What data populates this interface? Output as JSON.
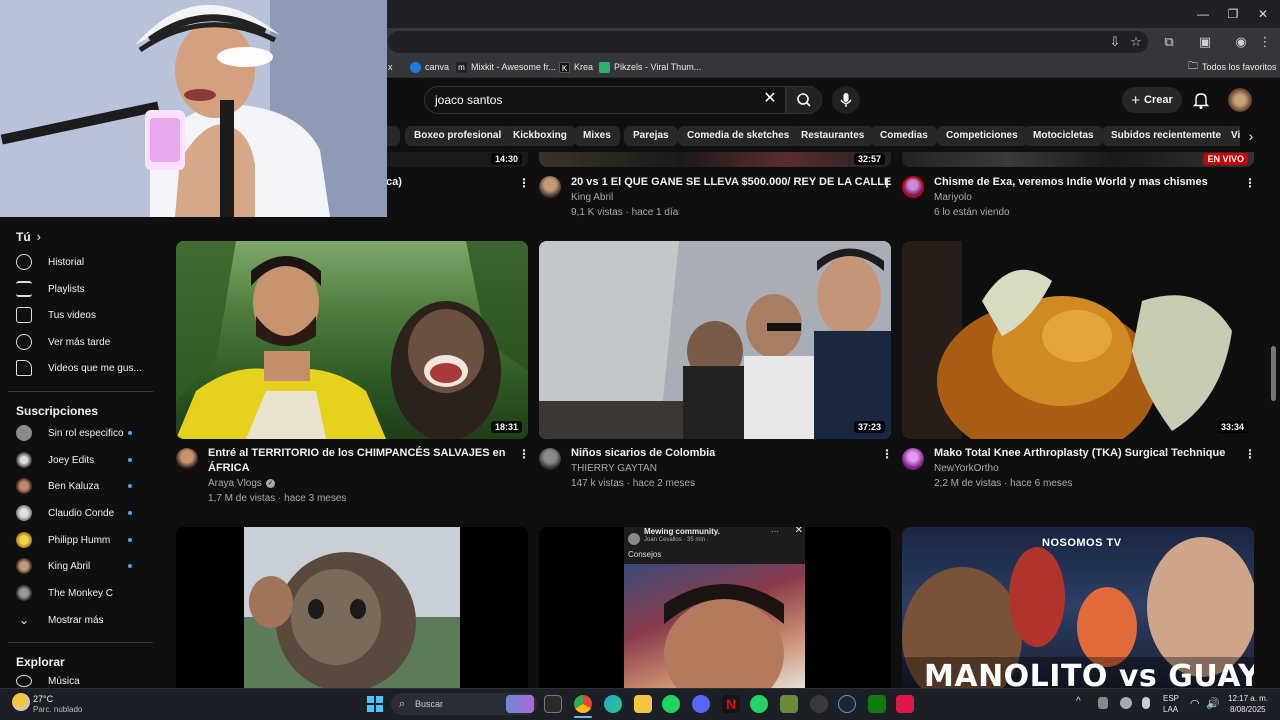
{
  "browser": {
    "bookmarks": [
      {
        "label": "x",
        "color": "#444"
      },
      {
        "label": "canva",
        "color": "#1f7bd8"
      },
      {
        "label": "Mixkit - Awesome fr...",
        "color": "#222"
      },
      {
        "label": "Krea",
        "color": "#111"
      },
      {
        "label": "Pikzels - Viral Thum...",
        "color": "#27b36a"
      }
    ],
    "bookmarks_folder": "Todos los favoritos"
  },
  "header": {
    "search_value": "joaco santos",
    "create_label": "Crear"
  },
  "chips": [
    "Boxeo profesional",
    "Kickboxing",
    "Mixes",
    "Parejas",
    "Comedia de sketches",
    "Restaurantes",
    "Comedias",
    "Competiciones",
    "Motocicletas",
    "Subidos recientemente",
    "Vi"
  ],
  "chip_partial": "s",
  "sidebar": {
    "you_header": "Tú",
    "you_items": [
      "Historial",
      "Playlists",
      "Tus videos",
      "Ver más tarde",
      "Videos que me gus..."
    ],
    "subs_header": "Suscripciones",
    "subs": [
      "Sin rol especifico",
      "Joey Edits",
      "Ben Kaluza",
      "Claudio Conde",
      "Philipp Humm",
      "King Abril",
      "The Monkey C"
    ],
    "show_more": "Mostrar más",
    "explore_header": "Explorar",
    "explore_items": [
      "Música"
    ]
  },
  "top_row": [
    {
      "title_tail": "ca)",
      "durations": "14:30"
    },
    {
      "title": "20 vs 1 El QUE GANE SE LLEVA $500.000/ REY DE LA CALLE",
      "channel": "King Abril",
      "meta": "9,1 K vistas · hace 1 día",
      "duration": "32:57"
    },
    {
      "title": "Chisme de Exa, veremos Indie World y mas chismes",
      "channel": "Mariyolo",
      "meta": "6 lo están viendo",
      "badge": "EN VIVO"
    }
  ],
  "videos": [
    {
      "title": "Entré al TERRITORIO de los CHIMPANCÉS SALVAJES en ÁFRICA",
      "channel": "Araya Vlogs",
      "meta": "1,7 M de vistas · hace 3 meses",
      "duration": "18:31",
      "verified": true
    },
    {
      "title": "Niños sicarios de Colombia",
      "channel": "THIERRY GAYTAN",
      "meta": "147 k vistas · hace 2 meses",
      "duration": "37:23"
    },
    {
      "title": "Mako Total Knee Arthroplasty (TKA) Surgical Technique",
      "channel": "NewYorkOrtho",
      "meta": "2,2 M de vistas · hace 6 meses",
      "duration": "33:34"
    }
  ],
  "bottom_row": {
    "post": {
      "title": "Mewing community.",
      "author": "Joan Cevallos · 35 min ·",
      "text": "Consejos"
    },
    "brand": "NOSOMOS TV",
    "banner": "MANOLITO vs GUAYACO"
  },
  "taskbar": {
    "weather_temp": "27°C",
    "weather_desc": "Parc. nublado",
    "search_label": "Buscar",
    "lang_top": "ESP",
    "lang_bottom": "LAA",
    "time": "12:17 a. m.",
    "date": "8/08/2025"
  }
}
